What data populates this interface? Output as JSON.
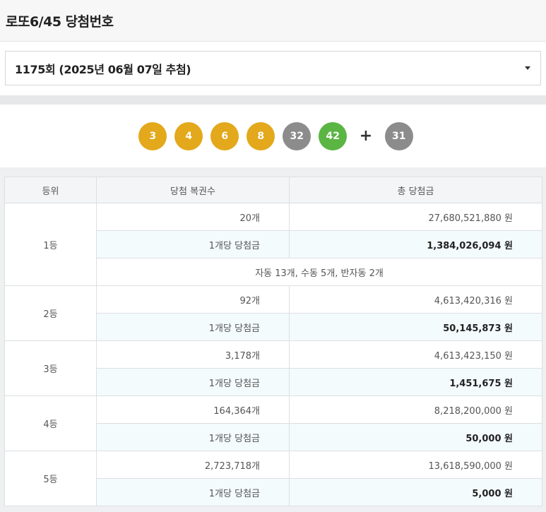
{
  "header": {
    "title": "로또6/45 당첨번호"
  },
  "draw_select": {
    "value": "1175회 (2025년 06월 07일 추첨)"
  },
  "balls": {
    "numbers": [
      {
        "n": "3",
        "color": "#e3a81b"
      },
      {
        "n": "4",
        "color": "#e3a81b"
      },
      {
        "n": "6",
        "color": "#e3a81b"
      },
      {
        "n": "8",
        "color": "#e3a81b"
      },
      {
        "n": "32",
        "color": "#8c8c8c"
      },
      {
        "n": "42",
        "color": "#5ab543"
      }
    ],
    "plus": "+",
    "bonus": {
      "n": "31",
      "color": "#8c8c8c"
    }
  },
  "table": {
    "headers": [
      "등위",
      "당첨 복권수",
      "총 당첨금"
    ],
    "ranks": [
      {
        "rank": "1등",
        "count": "20개",
        "total": "27,680,521,880 원",
        "per_label": "1개당 당첨금",
        "per_amount": "1,384,026,094 원",
        "note": "자동 13개, 수동 5개, 반자동 2개"
      },
      {
        "rank": "2등",
        "count": "92개",
        "total": "4,613,420,316 원",
        "per_label": "1개당 당첨금",
        "per_amount": "50,145,873 원"
      },
      {
        "rank": "3등",
        "count": "3,178개",
        "total": "4,613,423,150 원",
        "per_label": "1개당 당첨금",
        "per_amount": "1,451,675 원"
      },
      {
        "rank": "4등",
        "count": "164,364개",
        "total": "8,218,200,000 원",
        "per_label": "1개당 당첨금",
        "per_amount": "50,000 원"
      },
      {
        "rank": "5등",
        "count": "2,723,718개",
        "total": "13,618,590,000 원",
        "per_label": "1개당 당첨금",
        "per_amount": "5,000 원"
      }
    ]
  }
}
